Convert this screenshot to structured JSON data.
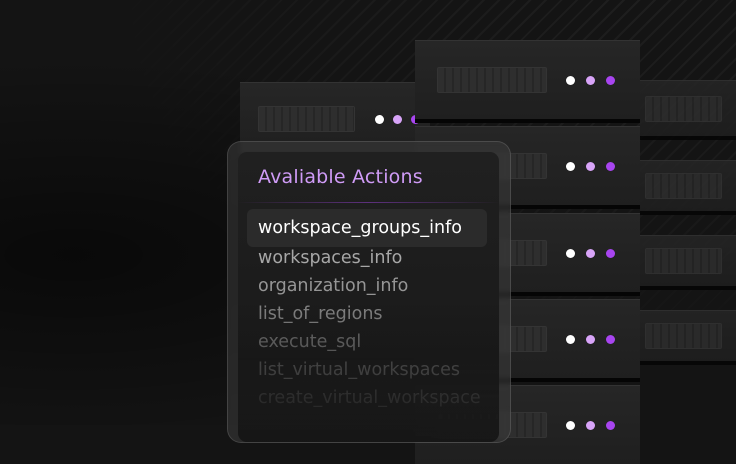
{
  "panel": {
    "title": "Avaliable Actions",
    "actions": [
      {
        "label": "workspace_groups_info",
        "selected": true
      },
      {
        "label": "workspaces_info",
        "selected": false
      },
      {
        "label": "organization_info",
        "selected": false
      },
      {
        "label": "list_of_regions",
        "selected": false
      },
      {
        "label": "execute_sql",
        "selected": false
      },
      {
        "label": "list_virtual_workspaces",
        "selected": false
      },
      {
        "label": "create_virtual_workspace",
        "selected": false
      }
    ]
  },
  "colors": {
    "accent_purple": "#a845f0",
    "accent_lilac": "#d8a4f8",
    "title_color": "#cf9bf6",
    "indicator_white": "#ffffff"
  },
  "icons": [
    "server-rack",
    "status-led"
  ]
}
